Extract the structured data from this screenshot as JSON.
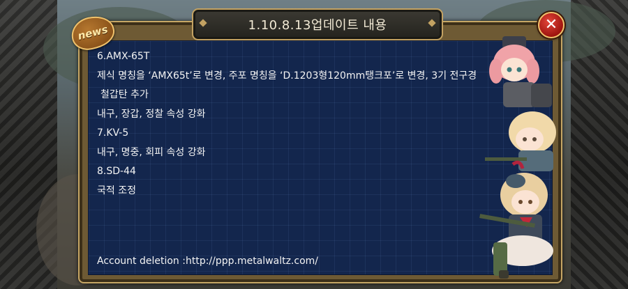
{
  "dialog": {
    "title": "1.10.8.13업데이트 내용",
    "badge": "news",
    "close_icon": "close-icon",
    "close_symbol": "✕"
  },
  "notes": [
    "6.AMX-65T",
    "제식 명칭을 ‘AMX65t’로 변경, 주포 명칭을 ‘D.1203형120mm탱크포’로 변경, 3기 전구경",
    "철갑탄 추가",
    "내구, 장갑, 정찰 속성 강화",
    "7.KV-5",
    "내구, 명중, 회피 속성 강화",
    "8.SD-44",
    "국적 조정"
  ],
  "footer": {
    "account_deletion": "Account deletion :http://ppp.metalwaltz.com/"
  },
  "colors": {
    "panel": "#13264d",
    "frame": "#c7a765",
    "close": "#d42b22",
    "text": "#f4f4f4"
  }
}
